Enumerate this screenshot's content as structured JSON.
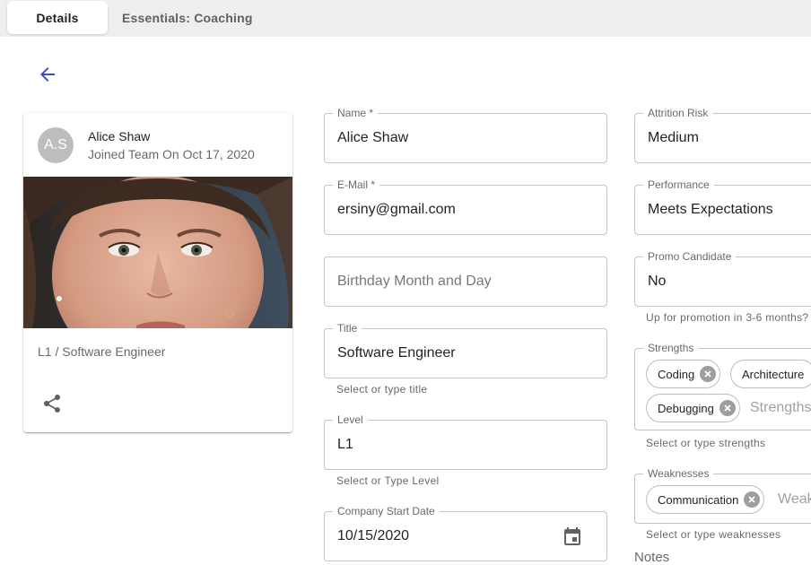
{
  "tabs": [
    {
      "label": "Details"
    },
    {
      "label": "Essentials: Coaching"
    }
  ],
  "profile": {
    "initials": "A.S",
    "name": "Alice Shaw",
    "joined": "Joined Team On Oct 17, 2020",
    "role": "L1 / Software Engineer"
  },
  "form": {
    "name": {
      "label": "Name *",
      "value": "Alice Shaw"
    },
    "email": {
      "label": "E-Mail *",
      "value": "ersiny@gmail.com"
    },
    "birthday": {
      "placeholder": "Birthday Month and Day"
    },
    "title": {
      "label": "Title",
      "value": "Software Engineer",
      "helper": "Select or type title"
    },
    "level": {
      "label": "Level",
      "value": "L1",
      "helper": "Select or Type Level"
    },
    "start_date": {
      "label": "Company Start Date",
      "value": "10/15/2020"
    },
    "attrition": {
      "label": "Attrition Risk",
      "value": "Medium"
    },
    "performance": {
      "label": "Performance",
      "value": "Meets Expectations"
    },
    "promo": {
      "label": "Promo Candidate",
      "value": "No",
      "helper": "Up for promotion in 3-6 months?"
    },
    "strengths": {
      "label": "Strengths",
      "chips": [
        "Coding",
        "Architecture",
        "Debugging"
      ],
      "placeholder": "Strengths",
      "helper": "Select or type strengths"
    },
    "weaknesses": {
      "label": "Weaknesses",
      "chips": [
        "Communication"
      ],
      "placeholder": "Weak",
      "helper": "Select or type weaknesses"
    },
    "notes_label": "Notes"
  },
  "colors": {
    "accent": "#3f51b5",
    "tabbar": "#eeeeee"
  }
}
